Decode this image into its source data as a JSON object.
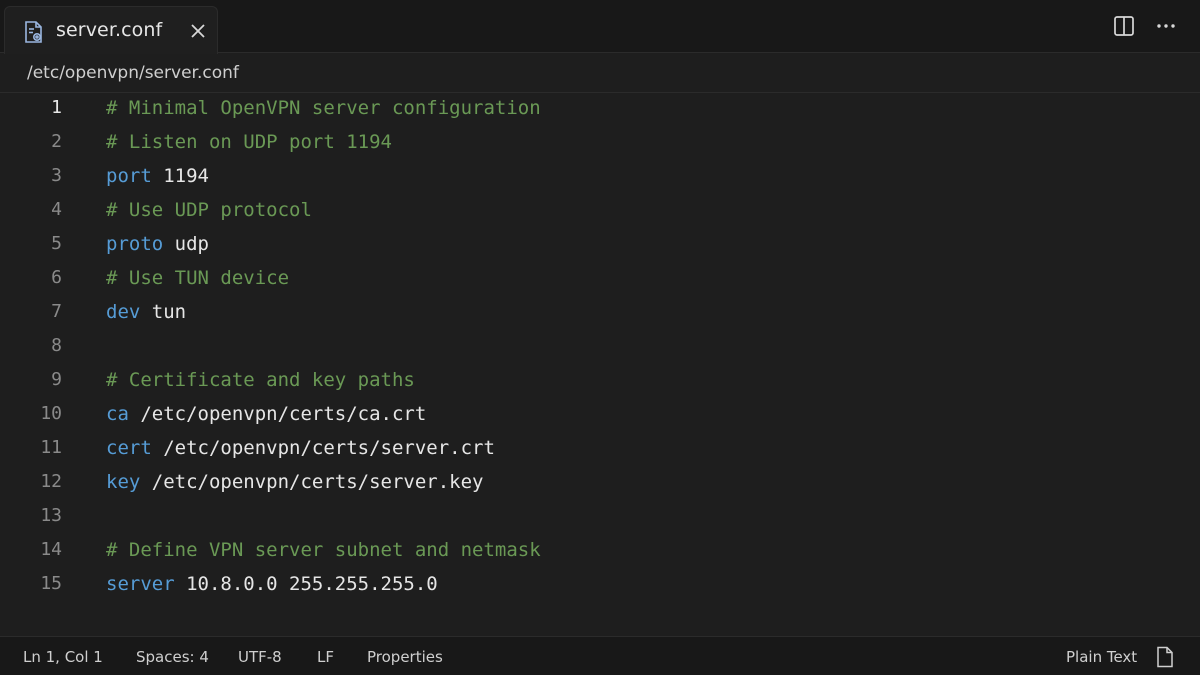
{
  "tab": {
    "title": "server.conf",
    "file_icon": "settings-file-icon",
    "close_icon": "close-icon"
  },
  "actions": {
    "split_icon": "split-editor-icon",
    "more_icon": "more-horizontal-icon"
  },
  "breadcrumb": "/etc/openvpn/server.conf",
  "editor": {
    "active_line": 1,
    "lines": [
      {
        "num": "1",
        "parts": [
          {
            "t": "# Minimal OpenVPN server configuration",
            "c": "cm"
          }
        ]
      },
      {
        "num": "2",
        "parts": [
          {
            "t": "# Listen on UDP port 1194",
            "c": "cm"
          }
        ]
      },
      {
        "num": "3",
        "parts": [
          {
            "t": "port",
            "c": "kw"
          },
          {
            "t": " 1194",
            "c": "val"
          }
        ]
      },
      {
        "num": "4",
        "parts": [
          {
            "t": "# Use UDP protocol",
            "c": "cm"
          }
        ]
      },
      {
        "num": "5",
        "parts": [
          {
            "t": "proto",
            "c": "kw"
          },
          {
            "t": " udp",
            "c": "val"
          }
        ]
      },
      {
        "num": "6",
        "parts": [
          {
            "t": "# Use TUN device",
            "c": "cm"
          }
        ]
      },
      {
        "num": "7",
        "parts": [
          {
            "t": "dev",
            "c": "kw"
          },
          {
            "t": " tun",
            "c": "val"
          }
        ]
      },
      {
        "num": "8",
        "parts": []
      },
      {
        "num": "9",
        "parts": [
          {
            "t": "# Certificate and key paths",
            "c": "cm"
          }
        ]
      },
      {
        "num": "10",
        "parts": [
          {
            "t": "ca",
            "c": "kw"
          },
          {
            "t": " /etc/openvpn/certs/ca.crt",
            "c": "val"
          }
        ]
      },
      {
        "num": "11",
        "parts": [
          {
            "t": "cert",
            "c": "kw"
          },
          {
            "t": " /etc/openvpn/certs/server.crt",
            "c": "val"
          }
        ]
      },
      {
        "num": "12",
        "parts": [
          {
            "t": "key",
            "c": "kw"
          },
          {
            "t": " /etc/openvpn/certs/server.key",
            "c": "val"
          }
        ]
      },
      {
        "num": "13",
        "parts": []
      },
      {
        "num": "14",
        "parts": [
          {
            "t": "# Define VPN server subnet and netmask",
            "c": "cm"
          }
        ]
      },
      {
        "num": "15",
        "parts": [
          {
            "t": "server",
            "c": "kw"
          },
          {
            "t": " 10.8.0.0 255.255.255.0",
            "c": "val"
          }
        ]
      }
    ]
  },
  "statusbar": {
    "position": "Ln 1, Col 1",
    "spaces": "Spaces: 4",
    "encoding": "UTF-8",
    "eol": "LF",
    "properties": "Properties",
    "language": "Plain Text",
    "file_icon": "document-icon"
  },
  "colors": {
    "background": "#1e1e1e",
    "comment": "#6a9955",
    "keyword": "#569cd6",
    "text": "#e6e6e6",
    "line_number": "#8a8a8a"
  }
}
